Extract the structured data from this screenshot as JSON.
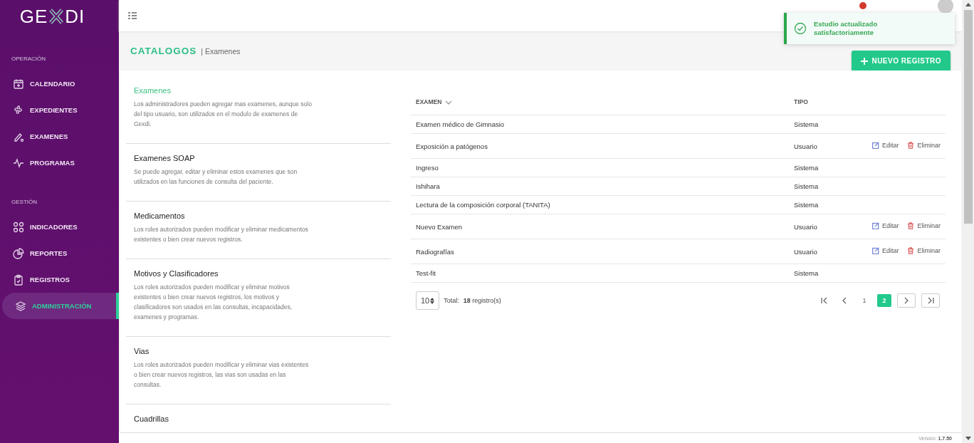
{
  "sidebar": {
    "logo": "GE",
    "logo_end": "DI",
    "sections": [
      {
        "title": "OPERACIÓN",
        "items": [
          {
            "label": "CALENDARIO",
            "selected": false
          },
          {
            "label": "EXPEDIENTES",
            "selected": false
          },
          {
            "label": "EXAMENES",
            "selected": false
          },
          {
            "label": "PROGRAMAS",
            "selected": false
          }
        ]
      },
      {
        "title": "GESTIÓN",
        "items": [
          {
            "label": "INDICADORES",
            "selected": false
          },
          {
            "label": "REPORTES",
            "selected": false
          },
          {
            "label": "REGISTROS",
            "selected": false
          },
          {
            "label": "ADMINISTRACIÓN",
            "selected": true
          }
        ]
      }
    ]
  },
  "page_header": {
    "title": "CATALOGOS",
    "subtitle": "| Examenes",
    "button": "NUEVO REGISTRO"
  },
  "catalogs": [
    {
      "title": "Examenes",
      "selected": true,
      "description": "Los administradores pueden agregar mas examenes, aunque solo del tipo usuario, son utilizados en el modulo de examenes de Gexdi."
    },
    {
      "title": "Examenes SOAP",
      "selected": false,
      "description": "Se puede agregar, editar y eliminar estos examenes que son utilizados en las funciones de consulta del paciente."
    },
    {
      "title": "Medicamentos",
      "selected": false,
      "description": "Los roles autorizados pueden modificar y eliminar medicamentos existentes o bien crear nuevos registros."
    },
    {
      "title": "Motivos y Clasificadores",
      "selected": false,
      "description": "Los roles autorizados pueden modificar y eliminar motivos existentes o bien crear nuevos registros, los motivos y clasificadores son usados en las consultas, incapacidades, examenes y programas."
    },
    {
      "title": "Vias",
      "selected": false,
      "description": "Los roles autorizados pueden modificar y eliminar vias existentes o bien crear nuevos registros, las vias son usadas en las consultas."
    },
    {
      "title": "Cuadrillas",
      "selected": false
    }
  ],
  "table": {
    "columns": [
      "EXAMEN",
      "TIPO"
    ],
    "rows": [
      {
        "examen": "Examen médico de Gimnasio",
        "tipo": "Sistema"
      },
      {
        "examen": "Exposición a patógenos",
        "tipo": "Usuario",
        "actions": [
          "Editar",
          "Eliminar"
        ]
      },
      {
        "examen": "Ingreso",
        "tipo": "Sistema"
      },
      {
        "examen": "Ishihara",
        "tipo": "Sistema"
      },
      {
        "examen": "Lectura de la composición corporal (TANITA)",
        "tipo": "Sistema"
      },
      {
        "examen": "Nuevo Examen",
        "tipo": "Usuario",
        "actions": [
          "Editar",
          "Eliminar"
        ]
      },
      {
        "examen": "Radiografías",
        "tipo": "Usuario",
        "actions": [
          "Editar",
          "Eliminar"
        ]
      },
      {
        "examen": "Test-fit",
        "tipo": "Sistema"
      }
    ]
  },
  "pagination": {
    "page_size": "10",
    "total_label": "Total:",
    "total": "**18** registro(s)",
    "pages": [
      {
        "label": "1",
        "selected": false
      },
      {
        "label": "2",
        "selected": true
      }
    ]
  },
  "toast": {
    "message": "Estudio actualizado satisfactoriamente"
  },
  "footer": {
    "version": "Versión: **1.7.50**"
  }
}
